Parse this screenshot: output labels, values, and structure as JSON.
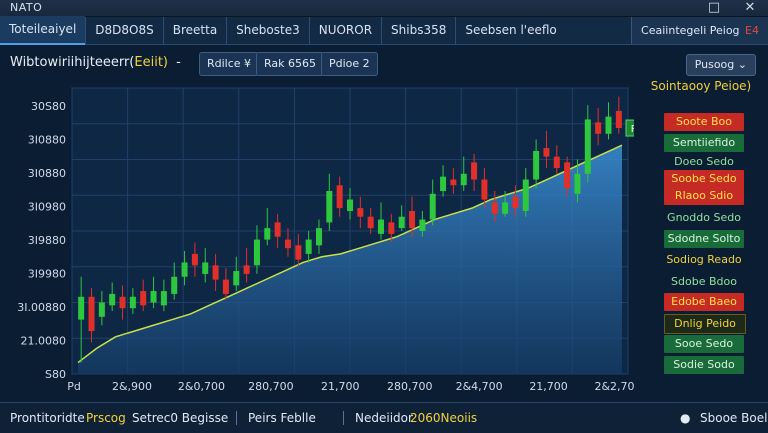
{
  "window": {
    "title": "NATO",
    "min_icon": "□",
    "close_icon": "✕"
  },
  "tabs": [
    {
      "label": "Toteileaiyel",
      "active": true
    },
    {
      "label": "D8D8O8S",
      "active": false
    },
    {
      "label": "Breetta",
      "active": false
    },
    {
      "label": "Sheboste3",
      "active": false
    },
    {
      "label": "NUOROR",
      "active": false
    },
    {
      "label": "Shibs358",
      "active": false
    },
    {
      "label": "Seebsen l'eeflo",
      "active": false
    }
  ],
  "right_tab": {
    "label": "Ceaiintegeli Peiog",
    "close": "E4"
  },
  "toolbar": {
    "symbol": "Wibtowiriihijteeerr(",
    "symbol_accent": "Eeiit)",
    "dash": "-",
    "pills": [
      "Rdilce ¥",
      "Rak 6565",
      "Pdioe 2"
    ],
    "right_button": "Pusoog ⌄"
  },
  "chart_data": {
    "type": "candlestick",
    "y_tick_labels": [
      "30S80",
      "3I0880",
      "3I0880",
      "3I0980",
      "3I9880",
      "3I9980",
      "3I.00880",
      "21.0080",
      "S80"
    ],
    "x_tick_labels": [
      "Pd",
      "2&,900",
      "2&0,700",
      "280,700",
      "21,700",
      "280,700",
      "2&4,700",
      "21,700",
      "2&2,700"
    ],
    "last_price_tag": "Pdo",
    "candles": [
      {
        "o": 19,
        "c": 27,
        "h": 34,
        "l": 4
      },
      {
        "o": 27,
        "c": 15,
        "h": 30,
        "l": 11
      },
      {
        "o": 20,
        "c": 25,
        "h": 29,
        "l": 17
      },
      {
        "o": 24,
        "c": 28,
        "h": 32,
        "l": 22
      },
      {
        "o": 27,
        "c": 23,
        "h": 31,
        "l": 19
      },
      {
        "o": 23,
        "c": 27,
        "h": 30,
        "l": 21
      },
      {
        "o": 29,
        "c": 24,
        "h": 33,
        "l": 22
      },
      {
        "o": 25,
        "c": 29,
        "h": 34,
        "l": 23
      },
      {
        "o": 24,
        "c": 29,
        "h": 33,
        "l": 22
      },
      {
        "o": 28,
        "c": 34,
        "h": 39,
        "l": 26
      },
      {
        "o": 34,
        "c": 39,
        "h": 43,
        "l": 31
      },
      {
        "o": 42,
        "c": 38,
        "h": 46,
        "l": 34
      },
      {
        "o": 35,
        "c": 39,
        "h": 44,
        "l": 32
      },
      {
        "o": 38,
        "c": 33,
        "h": 42,
        "l": 29
      },
      {
        "o": 33,
        "c": 28,
        "h": 37,
        "l": 26
      },
      {
        "o": 31,
        "c": 36,
        "h": 41,
        "l": 29
      },
      {
        "o": 38,
        "c": 35,
        "h": 44,
        "l": 32
      },
      {
        "o": 38,
        "c": 47,
        "h": 52,
        "l": 35
      },
      {
        "o": 47,
        "c": 51,
        "h": 58,
        "l": 45
      },
      {
        "o": 53,
        "c": 48,
        "h": 56,
        "l": 44
      },
      {
        "o": 47,
        "c": 44,
        "h": 51,
        "l": 41
      },
      {
        "o": 45,
        "c": 40,
        "h": 49,
        "l": 38
      },
      {
        "o": 42,
        "c": 47,
        "h": 50,
        "l": 39
      },
      {
        "o": 45,
        "c": 51,
        "h": 54,
        "l": 42
      },
      {
        "o": 53,
        "c": 64,
        "h": 70,
        "l": 50
      },
      {
        "o": 66,
        "c": 58,
        "h": 69,
        "l": 55
      },
      {
        "o": 57,
        "c": 61,
        "h": 65,
        "l": 54
      },
      {
        "o": 58,
        "c": 55,
        "h": 62,
        "l": 51
      },
      {
        "o": 55,
        "c": 51,
        "h": 58,
        "l": 49
      },
      {
        "o": 49,
        "c": 54,
        "h": 60,
        "l": 47
      },
      {
        "o": 53,
        "c": 49,
        "h": 56,
        "l": 46
      },
      {
        "o": 51,
        "c": 55,
        "h": 59,
        "l": 50
      },
      {
        "o": 57,
        "c": 51,
        "h": 62,
        "l": 48
      },
      {
        "o": 50,
        "c": 54,
        "h": 57,
        "l": 48
      },
      {
        "o": 54,
        "c": 63,
        "h": 68,
        "l": 52
      },
      {
        "o": 64,
        "c": 69,
        "h": 73,
        "l": 62
      },
      {
        "o": 68,
        "c": 66,
        "h": 72,
        "l": 63
      },
      {
        "o": 66,
        "c": 70,
        "h": 76,
        "l": 64
      },
      {
        "o": 74,
        "c": 68,
        "h": 77,
        "l": 64
      },
      {
        "o": 68,
        "c": 61,
        "h": 72,
        "l": 58
      },
      {
        "o": 60,
        "c": 56,
        "h": 64,
        "l": 53
      },
      {
        "o": 56,
        "c": 60,
        "h": 64,
        "l": 55
      },
      {
        "o": 62,
        "c": 58,
        "h": 66,
        "l": 55
      },
      {
        "o": 57,
        "c": 68,
        "h": 72,
        "l": 55
      },
      {
        "o": 68,
        "c": 78,
        "h": 82,
        "l": 65
      },
      {
        "o": 79,
        "c": 76,
        "h": 85,
        "l": 72
      },
      {
        "o": 76,
        "c": 72,
        "h": 80,
        "l": 70
      },
      {
        "o": 74,
        "c": 65,
        "h": 76,
        "l": 62
      },
      {
        "o": 63,
        "c": 70,
        "h": 75,
        "l": 60
      },
      {
        "o": 70,
        "c": 89,
        "h": 94,
        "l": 67
      },
      {
        "o": 88,
        "c": 84,
        "h": 93,
        "l": 80
      },
      {
        "o": 84,
        "c": 90,
        "h": 95,
        "l": 82
      },
      {
        "o": 92,
        "c": 86,
        "h": 97,
        "l": 84
      }
    ],
    "ma": [
      4,
      9,
      13,
      15,
      17,
      19,
      21,
      24,
      27,
      30,
      33,
      36,
      39,
      41,
      42,
      44,
      46,
      48,
      51,
      54,
      56,
      58,
      61,
      63,
      65,
      68,
      71,
      74,
      77,
      80
    ]
  },
  "side_panel": {
    "title": "Sointaooy Peioe)",
    "rows": [
      {
        "text": "Soote Boo",
        "style": "red"
      },
      {
        "text": "Semtiiefido",
        "style": "green"
      },
      {
        "text": "Doeo Sedo",
        "style": "text-green"
      },
      {
        "text": "Soobe Sedo",
        "style": "red"
      },
      {
        "text": "Rlaoo Sdio",
        "style": "red"
      },
      {
        "text": "Gnoddo Sedo",
        "style": "text-green"
      },
      {
        "text": "Sdodne Solto",
        "style": "green"
      },
      {
        "text": "Sodiog Reado",
        "style": "text-yellow"
      },
      {
        "text": "Sdobe Bdoo",
        "style": "text-green"
      },
      {
        "text": "Edobe Baeo",
        "style": "red"
      },
      {
        "text": "Dnlig Peido",
        "style": "dark"
      },
      {
        "text": "Sooe Sedo",
        "style": "green"
      },
      {
        "text": "Sodie Sodo",
        "style": "green"
      }
    ]
  },
  "status": {
    "left_a": "Prontitoridte",
    "left_b": "Prscog",
    "left_c": "Setrec0 Begisse",
    "mid_a": "Peirs Feblle",
    "right_a": "Nedeiidor",
    "right_b": "2060Neoiis",
    "far_right": "Sbooe Boel"
  }
}
